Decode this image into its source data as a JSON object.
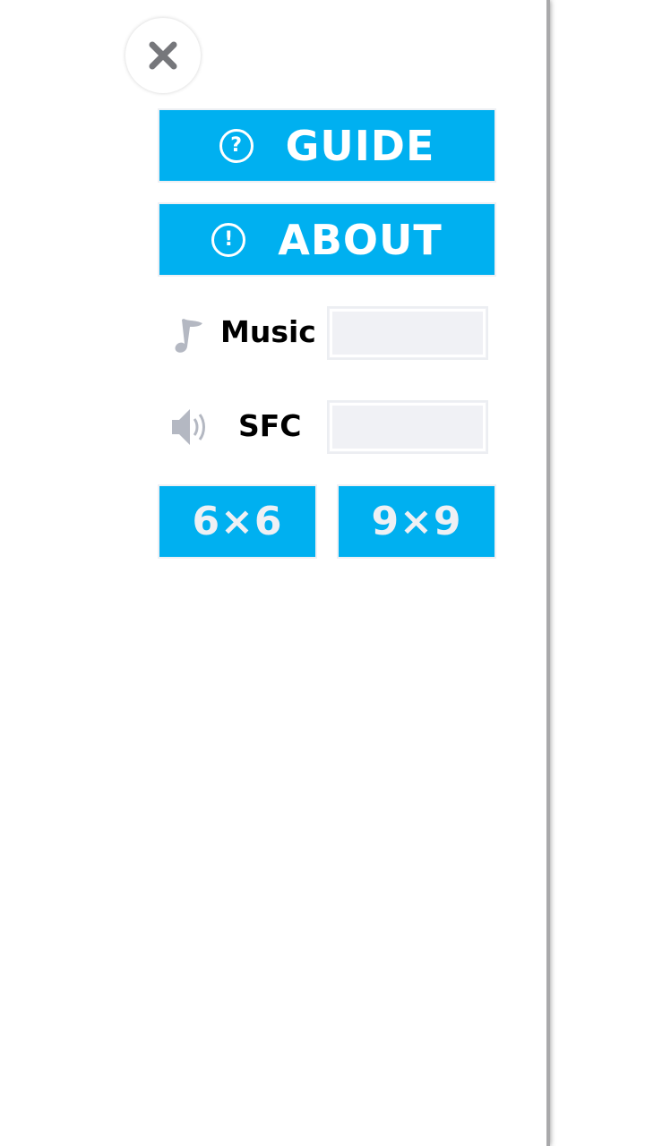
{
  "menu": {
    "close_icon": "close-icon",
    "guide": {
      "label": "GUIDE",
      "icon": "question-circle-icon",
      "icon_glyph": "?"
    },
    "about": {
      "label": "ABOUT",
      "icon": "exclamation-circle-icon",
      "icon_glyph": "!"
    },
    "music": {
      "label": "Music",
      "icon": "music-note-icon"
    },
    "sfc": {
      "label": "SFC",
      "icon": "speaker-icon"
    },
    "grid_6": {
      "label": "6×6"
    },
    "grid_9": {
      "label": "9×9"
    }
  },
  "colors": {
    "accent": "#00b0f0",
    "icon_gray": "#b4b8c2",
    "close_gray": "#76777b"
  }
}
